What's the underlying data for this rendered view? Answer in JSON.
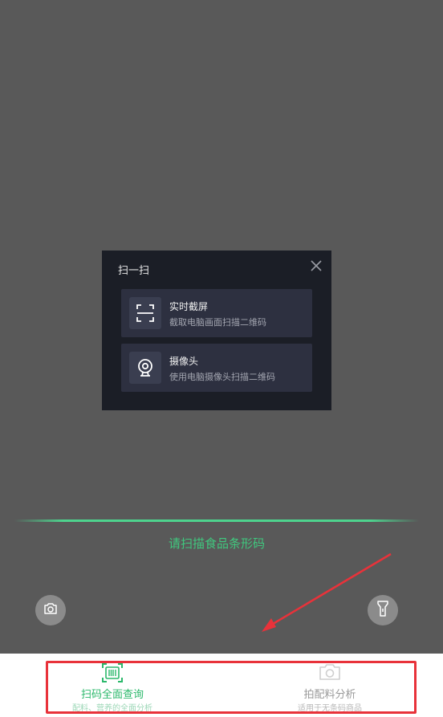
{
  "dialog": {
    "title": "扫一扫",
    "close_icon": "close-icon",
    "options": [
      {
        "title": "实时截屏",
        "desc": "截取电脑画面扫描二维码",
        "icon": "screenshot-frame-icon"
      },
      {
        "title": "摄像头",
        "desc": "使用电脑摄像头扫描二维码",
        "icon": "webcam-icon"
      }
    ]
  },
  "scanner": {
    "hint": "请扫描食品条形码",
    "line_color": "#4ed38e",
    "album_icon": "camera-icon",
    "torch_icon": "flashlight-icon"
  },
  "tabs": [
    {
      "label": "扫码全面查询",
      "sub": "配料、营养的全面分析",
      "icon": "barcode-scan-icon",
      "active": true
    },
    {
      "label": "拍配料分析",
      "sub": "适用于无条码商品",
      "icon": "camera-icon",
      "active": false
    }
  ],
  "colors": {
    "accent": "#2bb86b",
    "highlight": "#e8323a",
    "dialog_bg": "#1b1e26",
    "option_bg": "#2d3040"
  }
}
